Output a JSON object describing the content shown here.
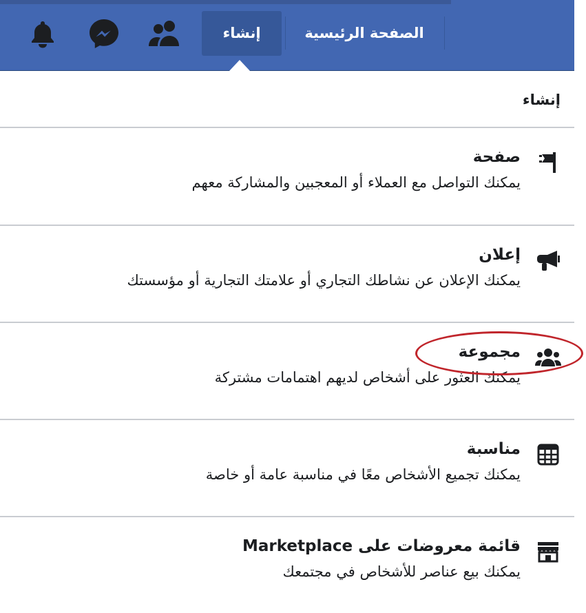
{
  "header": {
    "home_label": "الصفحة الرئيسية",
    "create_label": "إنشاء",
    "icons": [
      "friends-icon",
      "messenger-icon",
      "notifications-icon"
    ]
  },
  "panel": {
    "title": "إنشاء",
    "items": [
      {
        "icon": "flag-icon",
        "title": "صفحة",
        "description": "يمكنك التواصل مع العملاء أو المعجبين والمشاركة معهم"
      },
      {
        "icon": "megaphone-icon",
        "title": "إعلان",
        "description": "يمكنك الإعلان عن نشاطك التجاري أو علامتك التجارية أو مؤسستك"
      },
      {
        "icon": "group-icon",
        "title": "مجموعة",
        "description": "يمكنك العثور على أشخاص لديهم اهتمامات مشتركة"
      },
      {
        "icon": "calendar-icon",
        "title": "مناسبة",
        "description": "يمكنك تجميع الأشخاص معًا في مناسبة عامة أو خاصة"
      },
      {
        "icon": "shop-icon",
        "title": "قائمة معروضات على Marketplace",
        "description": "يمكنك بيع عناصر للأشخاص في مجتمعك"
      }
    ]
  },
  "colors": {
    "header_bg": "#4267b2",
    "active_tab_bg": "#365899",
    "highlight": "#c0252b"
  }
}
